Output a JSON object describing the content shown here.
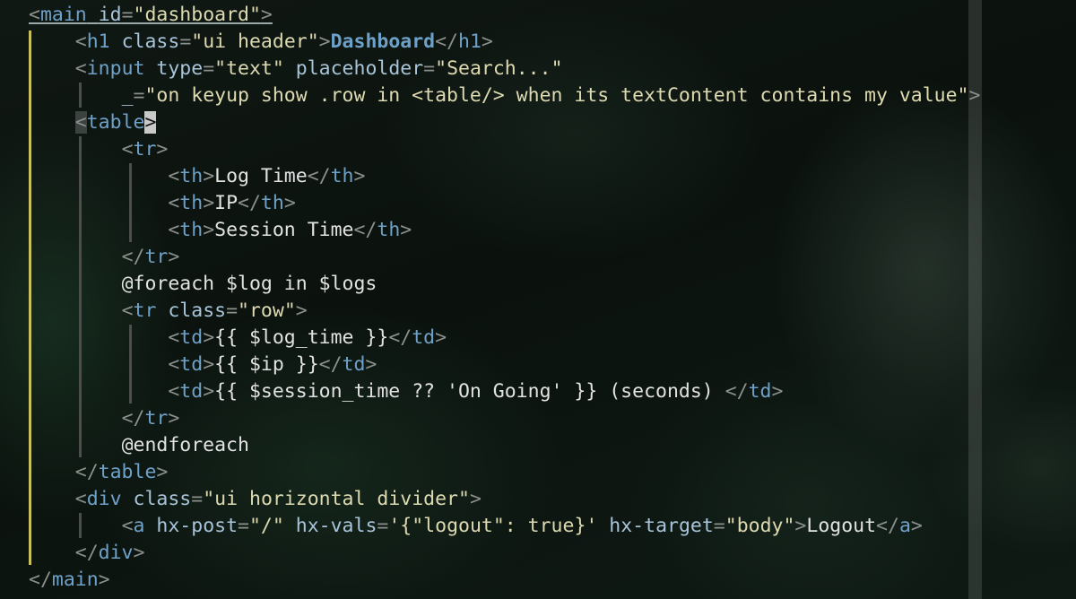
{
  "editor": {
    "lines": [
      {
        "indent": "",
        "tokens": [
          {
            "t": "<",
            "c": "p u"
          },
          {
            "t": "main",
            "c": "t u"
          },
          {
            "t": " ",
            "c": "x u"
          },
          {
            "t": "id",
            "c": "a u"
          },
          {
            "t": "=",
            "c": "p u"
          },
          {
            "t": "\"dashboard\"",
            "c": "s u"
          },
          {
            "t": ">",
            "c": "p u"
          }
        ]
      },
      {
        "indent": "    ",
        "tokens": [
          {
            "t": "<",
            "c": "p"
          },
          {
            "t": "h1",
            "c": "t"
          },
          {
            "t": " ",
            "c": "x"
          },
          {
            "t": "class",
            "c": "a"
          },
          {
            "t": "=",
            "c": "p"
          },
          {
            "t": "\"ui header\"",
            "c": "s"
          },
          {
            "t": ">",
            "c": "p"
          },
          {
            "t": "Dashboard",
            "c": "b"
          },
          {
            "t": "</",
            "c": "p"
          },
          {
            "t": "h1",
            "c": "t"
          },
          {
            "t": ">",
            "c": "p"
          }
        ]
      },
      {
        "indent": "    ",
        "tokens": [
          {
            "t": "<",
            "c": "p"
          },
          {
            "t": "input",
            "c": "t"
          },
          {
            "t": " ",
            "c": "x"
          },
          {
            "t": "type",
            "c": "a"
          },
          {
            "t": "=",
            "c": "p"
          },
          {
            "t": "\"text\"",
            "c": "s"
          },
          {
            "t": " ",
            "c": "x"
          },
          {
            "t": "placeholder",
            "c": "a"
          },
          {
            "t": "=",
            "c": "p"
          },
          {
            "t": "\"Search...\"",
            "c": "s"
          }
        ]
      },
      {
        "indent": "        ",
        "tokens": [
          {
            "t": "_",
            "c": "a"
          },
          {
            "t": "=",
            "c": "p"
          },
          {
            "t": "\"on keyup show .row in <table/> when its textContent contains my value\"",
            "c": "s"
          },
          {
            "t": ">",
            "c": "p"
          }
        ]
      },
      {
        "indent": "    ",
        "tokens": [
          {
            "t": "<",
            "c": "p hl"
          },
          {
            "t": "table",
            "c": "t"
          },
          {
            "t": ">",
            "c": "cur"
          }
        ]
      },
      {
        "indent": "        ",
        "tokens": [
          {
            "t": "<",
            "c": "p"
          },
          {
            "t": "tr",
            "c": "t"
          },
          {
            "t": ">",
            "c": "p"
          }
        ]
      },
      {
        "indent": "            ",
        "tokens": [
          {
            "t": "<",
            "c": "p"
          },
          {
            "t": "th",
            "c": "t"
          },
          {
            "t": ">",
            "c": "p"
          },
          {
            "t": "Log Time",
            "c": "x"
          },
          {
            "t": "</",
            "c": "p"
          },
          {
            "t": "th",
            "c": "t"
          },
          {
            "t": ">",
            "c": "p"
          }
        ]
      },
      {
        "indent": "            ",
        "tokens": [
          {
            "t": "<",
            "c": "p"
          },
          {
            "t": "th",
            "c": "t"
          },
          {
            "t": ">",
            "c": "p"
          },
          {
            "t": "IP",
            "c": "x"
          },
          {
            "t": "</",
            "c": "p"
          },
          {
            "t": "th",
            "c": "t"
          },
          {
            "t": ">",
            "c": "p"
          }
        ]
      },
      {
        "indent": "            ",
        "tokens": [
          {
            "t": "<",
            "c": "p"
          },
          {
            "t": "th",
            "c": "t"
          },
          {
            "t": ">",
            "c": "p"
          },
          {
            "t": "Session Time",
            "c": "x"
          },
          {
            "t": "</",
            "c": "p"
          },
          {
            "t": "th",
            "c": "t"
          },
          {
            "t": ">",
            "c": "p"
          }
        ]
      },
      {
        "indent": "        ",
        "tokens": [
          {
            "t": "</",
            "c": "p"
          },
          {
            "t": "tr",
            "c": "t"
          },
          {
            "t": ">",
            "c": "p"
          }
        ]
      },
      {
        "indent": "        ",
        "tokens": [
          {
            "t": "@foreach $log in $logs",
            "c": "x"
          }
        ]
      },
      {
        "indent": "        ",
        "tokens": [
          {
            "t": "<",
            "c": "p"
          },
          {
            "t": "tr",
            "c": "t"
          },
          {
            "t": " ",
            "c": "x"
          },
          {
            "t": "class",
            "c": "a"
          },
          {
            "t": "=",
            "c": "p"
          },
          {
            "t": "\"row\"",
            "c": "s"
          },
          {
            "t": ">",
            "c": "p"
          }
        ]
      },
      {
        "indent": "            ",
        "tokens": [
          {
            "t": "<",
            "c": "p"
          },
          {
            "t": "td",
            "c": "t"
          },
          {
            "t": ">",
            "c": "p"
          },
          {
            "t": "{{ $log_time }}",
            "c": "x"
          },
          {
            "t": "</",
            "c": "p"
          },
          {
            "t": "td",
            "c": "t"
          },
          {
            "t": ">",
            "c": "p"
          }
        ]
      },
      {
        "indent": "            ",
        "tokens": [
          {
            "t": "<",
            "c": "p"
          },
          {
            "t": "td",
            "c": "t"
          },
          {
            "t": ">",
            "c": "p"
          },
          {
            "t": "{{ $ip }}",
            "c": "x"
          },
          {
            "t": "</",
            "c": "p"
          },
          {
            "t": "td",
            "c": "t"
          },
          {
            "t": ">",
            "c": "p"
          }
        ]
      },
      {
        "indent": "            ",
        "tokens": [
          {
            "t": "<",
            "c": "p"
          },
          {
            "t": "td",
            "c": "t"
          },
          {
            "t": ">",
            "c": "p"
          },
          {
            "t": "{{ $session_time ?? 'On Going' }} (seconds) ",
            "c": "x"
          },
          {
            "t": "</",
            "c": "p"
          },
          {
            "t": "td",
            "c": "t"
          },
          {
            "t": ">",
            "c": "p"
          }
        ]
      },
      {
        "indent": "        ",
        "tokens": [
          {
            "t": "</",
            "c": "p"
          },
          {
            "t": "tr",
            "c": "t"
          },
          {
            "t": ">",
            "c": "p"
          }
        ]
      },
      {
        "indent": "        ",
        "tokens": [
          {
            "t": "@endforeach",
            "c": "x"
          }
        ]
      },
      {
        "indent": "    ",
        "tokens": [
          {
            "t": "</",
            "c": "p"
          },
          {
            "t": "table",
            "c": "t"
          },
          {
            "t": ">",
            "c": "p"
          }
        ]
      },
      {
        "indent": "    ",
        "tokens": [
          {
            "t": "<",
            "c": "p"
          },
          {
            "t": "div",
            "c": "t"
          },
          {
            "t": " ",
            "c": "x"
          },
          {
            "t": "class",
            "c": "a"
          },
          {
            "t": "=",
            "c": "p"
          },
          {
            "t": "\"ui horizontal divider\"",
            "c": "s"
          },
          {
            "t": ">",
            "c": "p"
          }
        ]
      },
      {
        "indent": "        ",
        "tokens": [
          {
            "t": "<",
            "c": "p"
          },
          {
            "t": "a",
            "c": "t"
          },
          {
            "t": " ",
            "c": "x"
          },
          {
            "t": "hx-post",
            "c": "a"
          },
          {
            "t": "=",
            "c": "p"
          },
          {
            "t": "\"/\"",
            "c": "s"
          },
          {
            "t": " ",
            "c": "x"
          },
          {
            "t": "hx-vals",
            "c": "a"
          },
          {
            "t": "=",
            "c": "p"
          },
          {
            "t": "'{\"logout\": true}'",
            "c": "s"
          },
          {
            "t": " ",
            "c": "x"
          },
          {
            "t": "hx-target",
            "c": "a"
          },
          {
            "t": "=",
            "c": "p"
          },
          {
            "t": "\"body\"",
            "c": "s"
          },
          {
            "t": ">",
            "c": "p"
          },
          {
            "t": "Logout",
            "c": "x"
          },
          {
            "t": "</",
            "c": "p"
          },
          {
            "t": "a",
            "c": "t"
          },
          {
            "t": ">",
            "c": "p"
          }
        ]
      },
      {
        "indent": "    ",
        "tokens": [
          {
            "t": "</",
            "c": "p"
          },
          {
            "t": "div",
            "c": "t"
          },
          {
            "t": ">",
            "c": "p"
          }
        ]
      },
      {
        "indent": "",
        "tokens": [
          {
            "t": "</",
            "c": "p"
          },
          {
            "t": "main",
            "c": "t"
          },
          {
            "t": ">",
            "c": "p"
          }
        ]
      }
    ],
    "colors": {
      "tag": "#6ea1c8",
      "attribute": "#a8c4d9",
      "string": "#ddd9b0",
      "text": "#e2e2e2",
      "punctuation": "#8c908d",
      "indent_guide_active": "#c8c05a",
      "indent_guide": "#4a4f4c"
    }
  }
}
